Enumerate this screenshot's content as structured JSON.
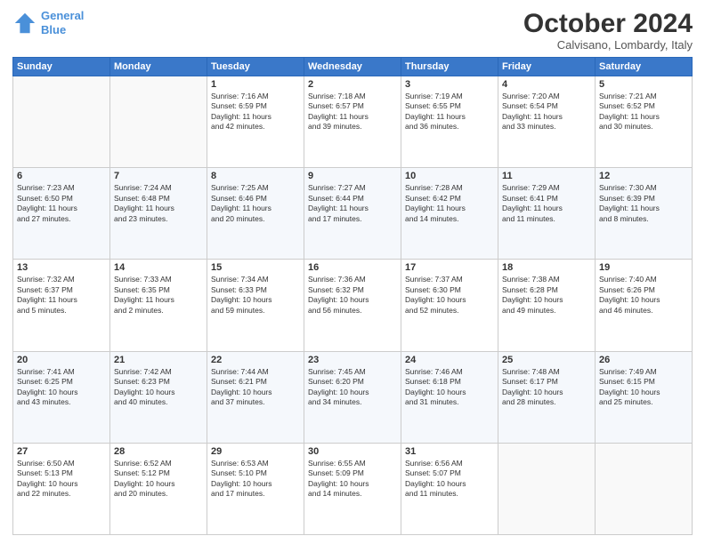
{
  "header": {
    "logo_line1": "General",
    "logo_line2": "Blue",
    "month_title": "October 2024",
    "location": "Calvisano, Lombardy, Italy"
  },
  "days_of_week": [
    "Sunday",
    "Monday",
    "Tuesday",
    "Wednesday",
    "Thursday",
    "Friday",
    "Saturday"
  ],
  "weeks": [
    [
      {
        "day": "",
        "content": ""
      },
      {
        "day": "",
        "content": ""
      },
      {
        "day": "1",
        "content": "Sunrise: 7:16 AM\nSunset: 6:59 PM\nDaylight: 11 hours\nand 42 minutes."
      },
      {
        "day": "2",
        "content": "Sunrise: 7:18 AM\nSunset: 6:57 PM\nDaylight: 11 hours\nand 39 minutes."
      },
      {
        "day": "3",
        "content": "Sunrise: 7:19 AM\nSunset: 6:55 PM\nDaylight: 11 hours\nand 36 minutes."
      },
      {
        "day": "4",
        "content": "Sunrise: 7:20 AM\nSunset: 6:54 PM\nDaylight: 11 hours\nand 33 minutes."
      },
      {
        "day": "5",
        "content": "Sunrise: 7:21 AM\nSunset: 6:52 PM\nDaylight: 11 hours\nand 30 minutes."
      }
    ],
    [
      {
        "day": "6",
        "content": "Sunrise: 7:23 AM\nSunset: 6:50 PM\nDaylight: 11 hours\nand 27 minutes."
      },
      {
        "day": "7",
        "content": "Sunrise: 7:24 AM\nSunset: 6:48 PM\nDaylight: 11 hours\nand 23 minutes."
      },
      {
        "day": "8",
        "content": "Sunrise: 7:25 AM\nSunset: 6:46 PM\nDaylight: 11 hours\nand 20 minutes."
      },
      {
        "day": "9",
        "content": "Sunrise: 7:27 AM\nSunset: 6:44 PM\nDaylight: 11 hours\nand 17 minutes."
      },
      {
        "day": "10",
        "content": "Sunrise: 7:28 AM\nSunset: 6:42 PM\nDaylight: 11 hours\nand 14 minutes."
      },
      {
        "day": "11",
        "content": "Sunrise: 7:29 AM\nSunset: 6:41 PM\nDaylight: 11 hours\nand 11 minutes."
      },
      {
        "day": "12",
        "content": "Sunrise: 7:30 AM\nSunset: 6:39 PM\nDaylight: 11 hours\nand 8 minutes."
      }
    ],
    [
      {
        "day": "13",
        "content": "Sunrise: 7:32 AM\nSunset: 6:37 PM\nDaylight: 11 hours\nand 5 minutes."
      },
      {
        "day": "14",
        "content": "Sunrise: 7:33 AM\nSunset: 6:35 PM\nDaylight: 11 hours\nand 2 minutes."
      },
      {
        "day": "15",
        "content": "Sunrise: 7:34 AM\nSunset: 6:33 PM\nDaylight: 10 hours\nand 59 minutes."
      },
      {
        "day": "16",
        "content": "Sunrise: 7:36 AM\nSunset: 6:32 PM\nDaylight: 10 hours\nand 56 minutes."
      },
      {
        "day": "17",
        "content": "Sunrise: 7:37 AM\nSunset: 6:30 PM\nDaylight: 10 hours\nand 52 minutes."
      },
      {
        "day": "18",
        "content": "Sunrise: 7:38 AM\nSunset: 6:28 PM\nDaylight: 10 hours\nand 49 minutes."
      },
      {
        "day": "19",
        "content": "Sunrise: 7:40 AM\nSunset: 6:26 PM\nDaylight: 10 hours\nand 46 minutes."
      }
    ],
    [
      {
        "day": "20",
        "content": "Sunrise: 7:41 AM\nSunset: 6:25 PM\nDaylight: 10 hours\nand 43 minutes."
      },
      {
        "day": "21",
        "content": "Sunrise: 7:42 AM\nSunset: 6:23 PM\nDaylight: 10 hours\nand 40 minutes."
      },
      {
        "day": "22",
        "content": "Sunrise: 7:44 AM\nSunset: 6:21 PM\nDaylight: 10 hours\nand 37 minutes."
      },
      {
        "day": "23",
        "content": "Sunrise: 7:45 AM\nSunset: 6:20 PM\nDaylight: 10 hours\nand 34 minutes."
      },
      {
        "day": "24",
        "content": "Sunrise: 7:46 AM\nSunset: 6:18 PM\nDaylight: 10 hours\nand 31 minutes."
      },
      {
        "day": "25",
        "content": "Sunrise: 7:48 AM\nSunset: 6:17 PM\nDaylight: 10 hours\nand 28 minutes."
      },
      {
        "day": "26",
        "content": "Sunrise: 7:49 AM\nSunset: 6:15 PM\nDaylight: 10 hours\nand 25 minutes."
      }
    ],
    [
      {
        "day": "27",
        "content": "Sunrise: 6:50 AM\nSunset: 5:13 PM\nDaylight: 10 hours\nand 22 minutes."
      },
      {
        "day": "28",
        "content": "Sunrise: 6:52 AM\nSunset: 5:12 PM\nDaylight: 10 hours\nand 20 minutes."
      },
      {
        "day": "29",
        "content": "Sunrise: 6:53 AM\nSunset: 5:10 PM\nDaylight: 10 hours\nand 17 minutes."
      },
      {
        "day": "30",
        "content": "Sunrise: 6:55 AM\nSunset: 5:09 PM\nDaylight: 10 hours\nand 14 minutes."
      },
      {
        "day": "31",
        "content": "Sunrise: 6:56 AM\nSunset: 5:07 PM\nDaylight: 10 hours\nand 11 minutes."
      },
      {
        "day": "",
        "content": ""
      },
      {
        "day": "",
        "content": ""
      }
    ]
  ]
}
